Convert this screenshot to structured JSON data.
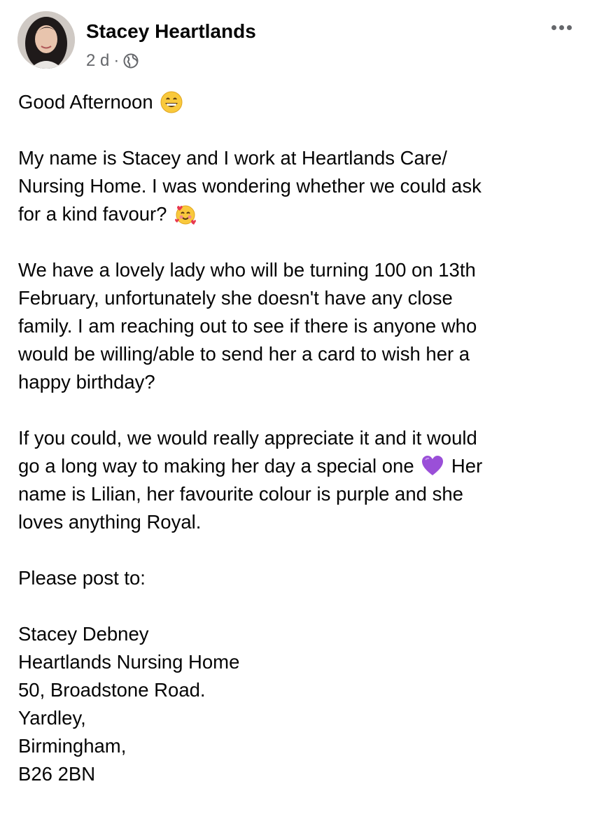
{
  "post": {
    "author": "Stacey Heartlands",
    "time": "2 d",
    "separator": "·",
    "audience_icon": "globe-icon",
    "more_icon": "more-options-icon"
  },
  "content": {
    "greeting": "Good Afternoon",
    "greeting_emoji": "grinning-face-emoji",
    "intro": "My name is Stacey and I work at Heartlands Care/\nNursing Home. I was wondering whether we could ask\nfor a kind favour?",
    "intro_emoji": "smiling-face-with-hearts-emoji",
    "request": "We have a lovely lady who will be turning 100 on 13th\nFebruary, unfortunately she doesn't have any close\nfamily. I am reaching out to see if there is anyone who\nwould be willing/able to send her a card to wish her a\nhappy birthday?",
    "appeal_part1": "If you could, we would really appreciate it and it would\ngo a long way to making her day a special one",
    "appeal_emoji": "purple-heart-emoji",
    "appeal_part2": "Her\nname is Lilian, her favourite colour is purple and she\nloves anything Royal.",
    "post_to_label": "Please post to:",
    "address": [
      "Stacey Debney",
      "Heartlands Nursing Home",
      "50, Broadstone Road.",
      "Yardley,",
      "Birmingham,",
      "B26 2BN"
    ]
  },
  "colors": {
    "name": "#050505",
    "meta": "#65676b",
    "purple_heart": "#9a4fd8"
  }
}
